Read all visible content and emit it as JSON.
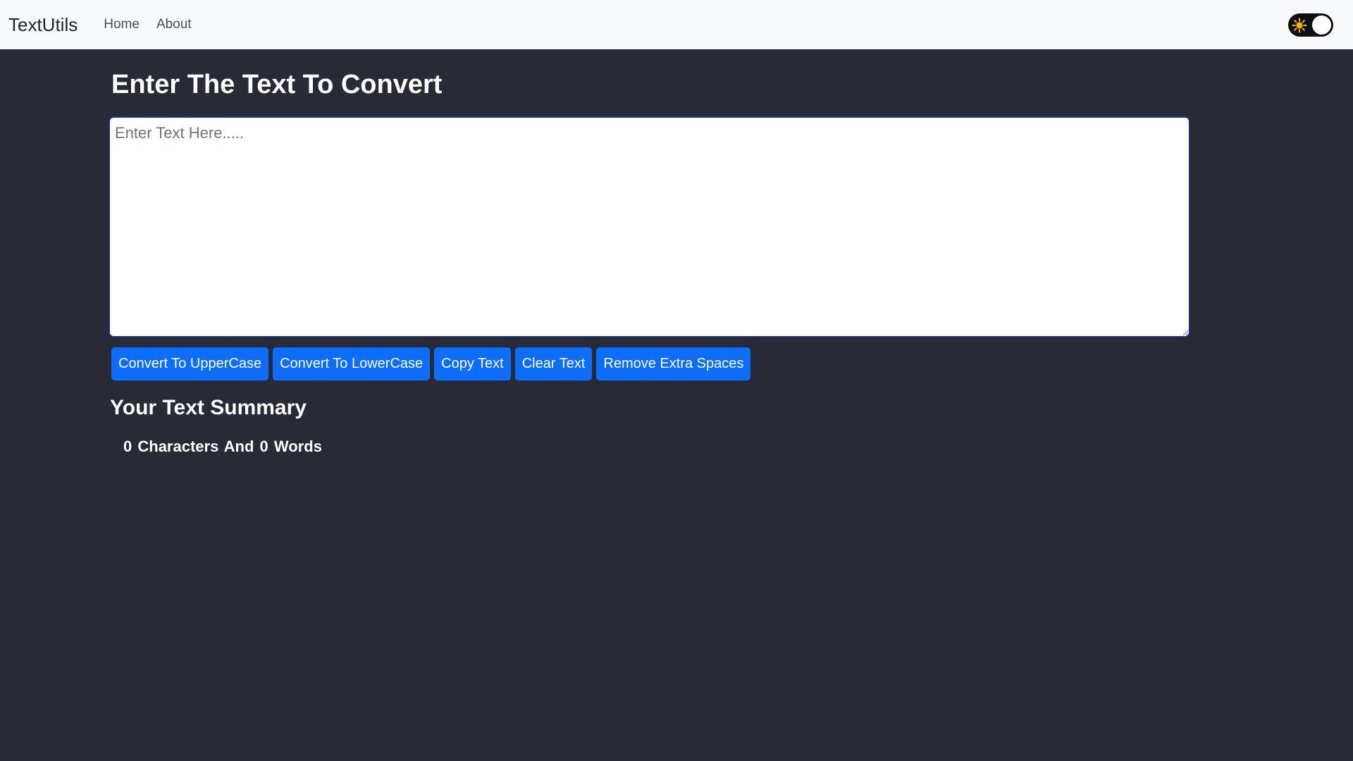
{
  "navbar": {
    "brand": "TextUtils",
    "links": [
      "Home",
      "About"
    ],
    "mode_toggle": {
      "icon": "sun-icon",
      "state": "dark"
    }
  },
  "main": {
    "heading": "Enter The Text To Convert",
    "textarea": {
      "value": "",
      "placeholder": "Enter Text Here....."
    },
    "buttons": [
      "Convert To UpperCase",
      "Convert To LowerCase",
      "Copy Text",
      "Clear Text",
      "Remove Extra Spaces"
    ],
    "summary_heading": "Your Text Summary",
    "summary": {
      "characters": "0",
      "characters_label": "Characters And",
      "words": "0",
      "words_label": "Words"
    }
  },
  "colors": {
    "page_bg": "#282b35",
    "navbar_bg": "#f8f9fa",
    "button_bg": "#0d6efd",
    "textarea_border": "#1f2a86"
  }
}
